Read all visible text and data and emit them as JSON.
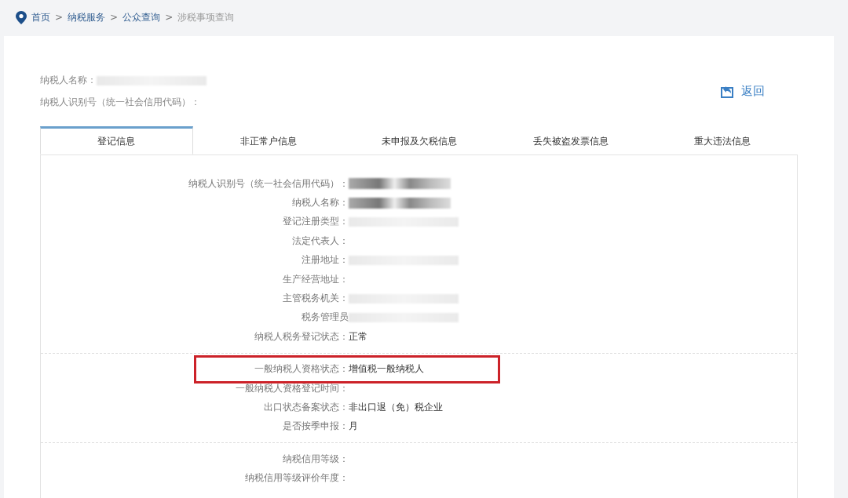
{
  "breadcrumb": [
    {
      "label": "首页",
      "current": false
    },
    {
      "label": "纳税服务",
      "current": false
    },
    {
      "label": "公众查询",
      "current": false
    },
    {
      "label": "涉税事项查询",
      "current": true
    }
  ],
  "breadcrumb_separator": ">",
  "header_fields": [
    {
      "label": "纳税人名称：",
      "redacted": true
    },
    {
      "label": "纳税人识别号（统一社会信用代码）：",
      "redacted": false
    }
  ],
  "back_link": "返回",
  "tabs": [
    {
      "label": "登记信息",
      "selected": true
    },
    {
      "label": "非正常户信息",
      "selected": false
    },
    {
      "label": "未申报及欠税信息",
      "selected": false
    },
    {
      "label": "丢失被盗发票信息",
      "selected": false
    },
    {
      "label": "重大违法信息",
      "selected": false
    }
  ],
  "groups": [
    {
      "rows": [
        {
          "label": "纳税人识别号（统一社会信用代码）：",
          "redacted": true,
          "highlighted": false
        },
        {
          "label": "纳税人名称：",
          "redacted": true,
          "highlighted": false
        },
        {
          "label": "登记注册类型：",
          "redacted": true,
          "highlighted": false
        },
        {
          "label": "法定代表人：",
          "redacted": false,
          "highlighted": false
        },
        {
          "label": "注册地址：",
          "redacted": true,
          "highlighted": false
        },
        {
          "label": "生产经营地址：",
          "redacted": false,
          "highlighted": false
        },
        {
          "label": "主管税务机关：",
          "redacted": true,
          "highlighted": false
        },
        {
          "label": "税务管理员",
          "redacted": true,
          "highlighted": false
        },
        {
          "label": "纳税人税务登记状态：",
          "value": "正常",
          "redacted": false,
          "highlighted": false
        }
      ]
    },
    {
      "rows": [
        {
          "label": "一般纳税人资格状态：",
          "value": "增值税一般纳税人",
          "redacted": false,
          "highlighted": true
        },
        {
          "label": "一般纳税人资格登记时间：",
          "redacted": false,
          "highlighted": false
        },
        {
          "label": "出口状态备案状态：",
          "value": "非出口退（免）税企业",
          "redacted": false,
          "highlighted": false
        },
        {
          "label": "是否按季申报：",
          "value": "月",
          "redacted": false,
          "highlighted": false
        }
      ]
    },
    {
      "rows": [
        {
          "label": "纳税信用等级：",
          "redacted": false,
          "highlighted": false
        },
        {
          "label": "纳税信用等级评价年度：",
          "redacted": false,
          "highlighted": false
        }
      ]
    }
  ]
}
